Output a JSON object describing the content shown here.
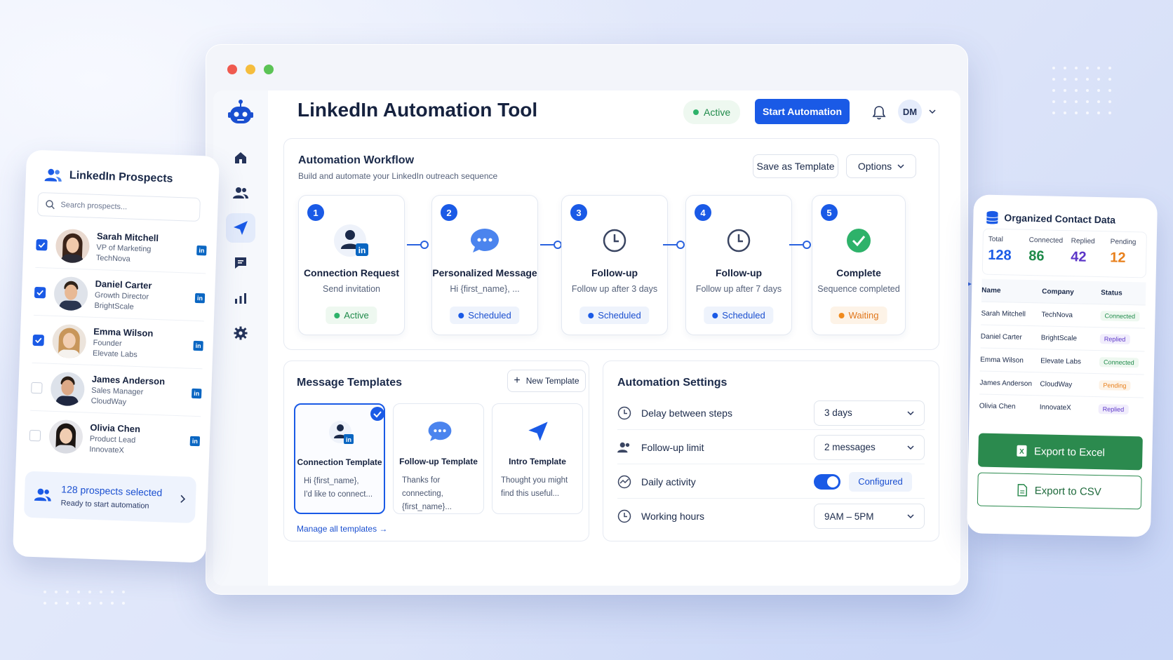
{
  "window": {
    "title": "LinkedIn Automation Tool",
    "status": "Active",
    "start_button": "Start Automation",
    "user_initials": "DM"
  },
  "workflow": {
    "title": "Automation Workflow",
    "subtitle": "Build and automate your LinkedIn outreach sequence",
    "save_button": "Save as Template",
    "options_button": "Options",
    "steps": [
      {
        "num": "1",
        "title": "Connection Request",
        "desc": "Send invitation",
        "status": "Active"
      },
      {
        "num": "2",
        "title": "Personalized Message",
        "desc": "Hi {first_name}, ...",
        "status": "Scheduled"
      },
      {
        "num": "3",
        "title": "Follow-up",
        "desc": "Follow up after 3 days",
        "status": "Scheduled"
      },
      {
        "num": "4",
        "title": "Follow-up",
        "desc": "Follow up after 7 days",
        "status": "Scheduled"
      },
      {
        "num": "5",
        "title": "Complete",
        "desc": "Sequence completed",
        "status": "Waiting"
      }
    ]
  },
  "templates": {
    "title": "Message Templates",
    "new_button": "New Template",
    "items": [
      {
        "title": "Connection Template",
        "line1": "Hi {first_name},",
        "line2": "I'd like to connect..."
      },
      {
        "title": "Follow-up Template",
        "line1": "Thanks for connecting,",
        "line2": "{first_name}..."
      },
      {
        "title": "Intro Template",
        "line1": "Thought you might",
        "line2": "find this useful..."
      }
    ],
    "manage_link": "Manage all templates →"
  },
  "settings": {
    "title": "Automation Settings",
    "delay": {
      "label": "Delay between steps",
      "value": "3 days"
    },
    "limit": {
      "label": "Follow-up limit",
      "value": "2 messages"
    },
    "daily": {
      "label": "Daily activity",
      "value": "Configured"
    },
    "hours": {
      "label": "Working hours",
      "value": "9AM – 5PM"
    }
  },
  "prospects": {
    "title": "LinkedIn Prospects",
    "search_placeholder": "Search prospects...",
    "items": [
      {
        "name": "Sarah Mitchell",
        "role": "VP of Marketing",
        "company": "TechNova",
        "checked": true
      },
      {
        "name": "Daniel Carter",
        "role": "Growth Director",
        "company": "BrightScale",
        "checked": true
      },
      {
        "name": "Emma Wilson",
        "role": "Founder",
        "company": "Elevate Labs",
        "checked": true
      },
      {
        "name": "James Anderson",
        "role": "Sales Manager",
        "company": "CloudWay",
        "checked": false
      },
      {
        "name": "Olivia Chen",
        "role": "Product Lead",
        "company": "InnovateX",
        "checked": false
      }
    ],
    "footer_title": "128 prospects selected",
    "footer_sub": "Ready to start automation"
  },
  "contacts": {
    "title": "Organized Contact Data",
    "stats": [
      {
        "label": "Total",
        "value": "128",
        "color": "#1a5ae6"
      },
      {
        "label": "Connected",
        "value": "86",
        "color": "#1f8a4a"
      },
      {
        "label": "Replied",
        "value": "42",
        "color": "#5b35c8"
      },
      {
        "label": "Pending",
        "value": "12",
        "color": "#e8801c"
      }
    ],
    "headers": [
      "Name",
      "Company",
      "Status"
    ],
    "rows": [
      {
        "name": "Sarah Mitchell",
        "company": "TechNova",
        "status": "Connected"
      },
      {
        "name": "Daniel Carter",
        "company": "BrightScale",
        "status": "Replied"
      },
      {
        "name": "Emma Wilson",
        "company": "Elevate Labs",
        "status": "Connected"
      },
      {
        "name": "James Anderson",
        "company": "CloudWay",
        "status": "Pending"
      },
      {
        "name": "Olivia Chen",
        "company": "InnovateX",
        "status": "Replied"
      }
    ],
    "excel_button": "Export to Excel",
    "csv_button": "Export to CSV"
  },
  "icons": [
    "robot-icon",
    "home-icon",
    "users-icon",
    "send-icon",
    "chat-icon",
    "chart-icon",
    "gear-icon",
    "bell-icon",
    "linkedin-icon",
    "clock-icon",
    "check-icon"
  ],
  "colors": {
    "primary": "#1a5ae6",
    "success": "#2eb26a",
    "warning": "#f08a1c",
    "excel": "#2b8a4e"
  }
}
